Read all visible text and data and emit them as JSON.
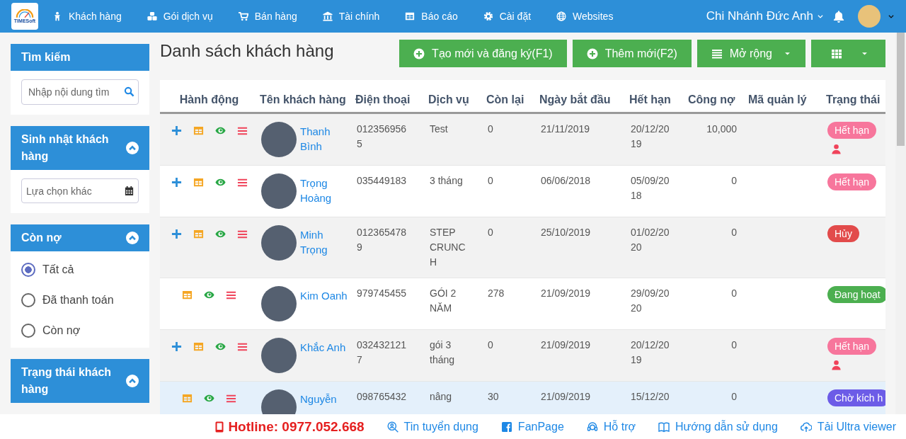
{
  "nav": {
    "logo": "TIMESoft",
    "menu": [
      {
        "label": "Khách hàng",
        "kind": "person"
      },
      {
        "label": "Gói dịch vụ",
        "kind": "cubes"
      },
      {
        "label": "Bán hàng",
        "kind": "cart"
      },
      {
        "label": "Tài chính",
        "kind": "bank"
      },
      {
        "label": "Báo cáo",
        "kind": "table"
      },
      {
        "label": "Cài đặt",
        "kind": "gear"
      },
      {
        "label": "Websites",
        "kind": "globe"
      }
    ],
    "branch": "Chi Nhánh Đức Anh"
  },
  "sidebar": {
    "search": {
      "title": "Tìm kiếm",
      "placeholder": "Nhập nội dung tìm"
    },
    "birthday": {
      "title": "Sinh nhật khách hàng",
      "placeholder": "Lựa chọn khác",
      "expanded": true
    },
    "debt": {
      "title": "Còn nợ",
      "expanded": true,
      "options": [
        {
          "label": "Tất cả",
          "selected": true
        },
        {
          "label": "Đã thanh toán",
          "selected": false
        },
        {
          "label": "Còn nợ",
          "selected": false
        }
      ]
    },
    "status": {
      "title": "Trạng thái khách hàng",
      "expanded": true
    }
  },
  "page": {
    "title": "Danh sách khách hàng",
    "buttons": [
      {
        "label": "Tạo mới và đăng ký(F1)",
        "kind": "plus"
      },
      {
        "label": "Thêm mới(F2)",
        "kind": "plus"
      },
      {
        "label": "Mở rộng",
        "kind": "list"
      },
      {
        "kind": "grid"
      }
    ]
  },
  "table": {
    "columns": [
      "Hành động",
      "Tên khách hàng",
      "Điện thoại",
      "Dịch vụ",
      "Còn lại",
      "Ngày bắt đầu",
      "Hết hạn",
      "Công nợ",
      "Mã quản lý",
      "Trạng thái"
    ],
    "rows": [
      {
        "can_add": true,
        "name": "Thanh Bình",
        "phone": "0123569565",
        "service": "Test",
        "remaining": "0",
        "start": "21/11/2019",
        "end": "20/12/2019",
        "debt": "10,000",
        "status": {
          "label": "Hết hạn",
          "color": "#f7769c"
        },
        "flagged": true,
        "selected": false
      },
      {
        "can_add": true,
        "name": "Trọng Hoàng",
        "phone": "035449183",
        "service": "3 tháng",
        "remaining": "0",
        "start": "06/06/2018",
        "end": "05/09/2018",
        "debt": "0",
        "status": {
          "label": "Hết hạn",
          "color": "#f7769c"
        },
        "flagged": false,
        "selected": false
      },
      {
        "can_add": true,
        "name": "Minh Trọng",
        "phone": "0123654789",
        "service": "STEP CRUNCH",
        "remaining": "0",
        "start": "25/10/2019",
        "end": "01/02/2020",
        "debt": "0",
        "status": {
          "label": "Hủy",
          "color": "#e24b4b"
        },
        "flagged": false,
        "selected": false
      },
      {
        "can_add": false,
        "name": "Kim Oanh",
        "phone": "979745455",
        "service": "GÓI 2 NĂM",
        "remaining": "278",
        "start": "21/09/2019",
        "end": "29/09/2020",
        "debt": "0",
        "status": {
          "label": "Đang hoạt",
          "color": "#4caf50"
        },
        "flagged": false,
        "selected": false
      },
      {
        "can_add": true,
        "name": "Khắc Anh",
        "phone": "0324321217",
        "service": "gói 3 tháng",
        "remaining": "0",
        "start": "21/09/2019",
        "end": "20/12/2019",
        "debt": "0",
        "status": {
          "label": "Hết hạn",
          "color": "#f7769c"
        },
        "flagged": true,
        "selected": false
      },
      {
        "can_add": false,
        "name": "Nguyễn",
        "phone": "098765432",
        "service": "nâng",
        "remaining": "30",
        "start": "21/09/2019",
        "end": "15/12/20",
        "debt": "0",
        "status": {
          "label": "Chờ kích h",
          "color": "#6c5ce7"
        },
        "flagged": false,
        "selected": true
      }
    ]
  },
  "footer": [
    {
      "label": "Hotline: 0977.052.668",
      "kind": "hotline"
    },
    {
      "label": "Tin tuyển dụng",
      "kind": "search-person"
    },
    {
      "label": "FanPage",
      "kind": "facebook"
    },
    {
      "label": "Hỗ trợ",
      "kind": "headset"
    },
    {
      "label": "Hướng dẫn sử dụng",
      "kind": "book"
    },
    {
      "label": "Tải Ultra viewer",
      "kind": "cloud"
    }
  ]
}
